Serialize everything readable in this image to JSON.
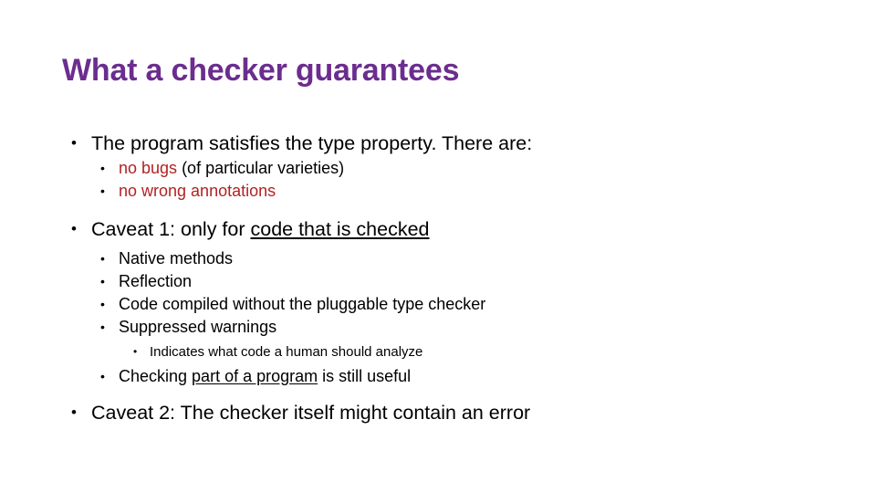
{
  "slide": {
    "title": "What a checker guarantees",
    "bullet_glyph": "•",
    "colors": {
      "title": "#6b2d8f",
      "body": "#000000",
      "highlight_red": "#b22222",
      "background": "#ffffff"
    },
    "lines": {
      "l1_program": {
        "text": "The program satisfies the type property.  There are:"
      },
      "l2_no_bugs": {
        "red_part": "no bugs",
        "black_part": " (of particular varieties)"
      },
      "l2_no_wrong_annotations": {
        "text": "no wrong annotations"
      },
      "l1_caveat1": {
        "lead": "Caveat 1:  only for ",
        "underlined": "code that is checked"
      },
      "l2_native_methods": {
        "text": "Native methods"
      },
      "l2_reflection": {
        "text": "Reflection"
      },
      "l2_code_compiled": {
        "text": "Code compiled without the pluggable type checker"
      },
      "l2_suppressed_warnings": {
        "text": "Suppressed warnings"
      },
      "l3_indicates": {
        "text": "Indicates what code a human should analyze"
      },
      "l2_checking": {
        "lead": "Checking ",
        "underlined": "part of a program",
        "tail": " is still useful"
      },
      "l1_caveat2": {
        "text": "Caveat 2:  The checker itself might contain an error"
      }
    }
  }
}
